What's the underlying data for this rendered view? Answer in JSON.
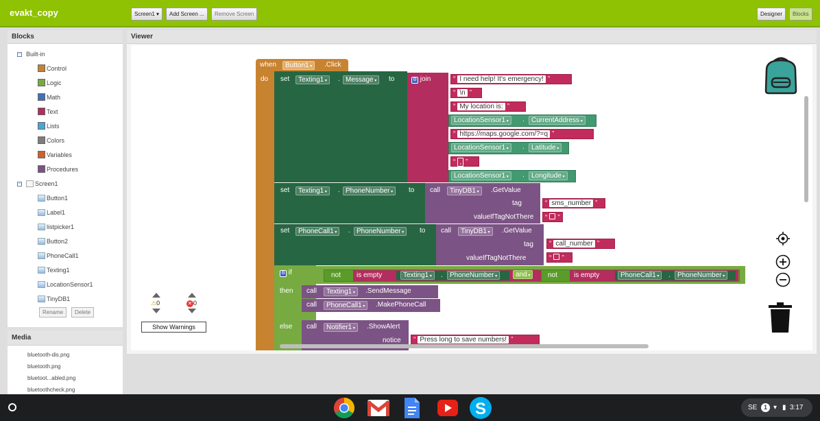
{
  "app": {
    "project_name": "evakt_copy"
  },
  "toolbar": {
    "screen_select": "Screen1",
    "add_screen": "Add Screen ...",
    "remove_screen": "Remove Screen",
    "designer": "Designer",
    "blocks": "Blocks"
  },
  "blocks_panel": {
    "title": "Blocks",
    "builtin_label": "Built-in",
    "builtin": [
      {
        "label": "Control",
        "color": "#c88330"
      },
      {
        "label": "Logic",
        "color": "#77ab41"
      },
      {
        "label": "Math",
        "color": "#3f71b5"
      },
      {
        "label": "Text",
        "color": "#b32d5e"
      },
      {
        "label": "Lists",
        "color": "#49a6d4"
      },
      {
        "label": "Colors",
        "color": "#7d7d7d"
      },
      {
        "label": "Variables",
        "color": "#d05f2d"
      },
      {
        "label": "Procedures",
        "color": "#7c5385"
      }
    ],
    "screen_label": "Screen1",
    "components": [
      {
        "label": "Button1",
        "icon": "button-icon"
      },
      {
        "label": "Label1",
        "icon": "label-icon"
      },
      {
        "label": "listpicker1",
        "icon": "listpicker-icon"
      },
      {
        "label": "Button2",
        "icon": "button-icon"
      },
      {
        "label": "PhoneCall1",
        "icon": "phonecall-icon"
      },
      {
        "label": "Texting1",
        "icon": "texting-icon"
      },
      {
        "label": "LocationSensor1",
        "icon": "location-icon"
      },
      {
        "label": "TinyDB1",
        "icon": "tinydb-icon"
      }
    ],
    "rename": "Rename",
    "delete": "Delete"
  },
  "media_panel": {
    "title": "Media",
    "files": [
      "bluetooth-dis.png",
      "bluetooth.png",
      "bluetoot...abled.png",
      "bluetoothcheck.png"
    ]
  },
  "viewer": {
    "title": "Viewer",
    "warnings_count": "0",
    "errors_count": "0",
    "show_warnings": "Show Warnings"
  },
  "code": {
    "when": "when",
    "button1": "Button1",
    "click": ".Click",
    "do": "do",
    "set": "set",
    "to": "to",
    "dot": ".",
    "texting1": "Texting1",
    "message": "Message",
    "join": "join",
    "s1": "I need help! It's emergency!",
    "s2": "\\n",
    "s3": "My location is:",
    "locsensor": "LocationSensor1",
    "curaddr": "CurrentAddress",
    "s4": "https://maps.google.com/?=q",
    "latitude": "Latitude",
    "s5": ",",
    "longitude": "Longitude",
    "phonenumber": "PhoneNumber",
    "call": "call",
    "tinydb1": "TinyDB1",
    "getvalue": ".GetValue",
    "tag": "tag",
    "sms_number": "sms_number",
    "valueiftagnotthere": "valueIfTagNotThere",
    "phonecall1": "PhoneCall1",
    "call_number": "call_number",
    "if": "if",
    "not": "not",
    "is_empty": "is empty",
    "and": "and",
    "then": "then",
    "sendmessage": ".SendMessage",
    "makephonecall": ".MakePhoneCall",
    "else": "else",
    "notifier1": "Notifier1",
    "showalert": ".ShowAlert",
    "notice": "notice",
    "s6": "Press long to save numbers!"
  },
  "status": {
    "lang": "SE",
    "time": "3:17"
  }
}
